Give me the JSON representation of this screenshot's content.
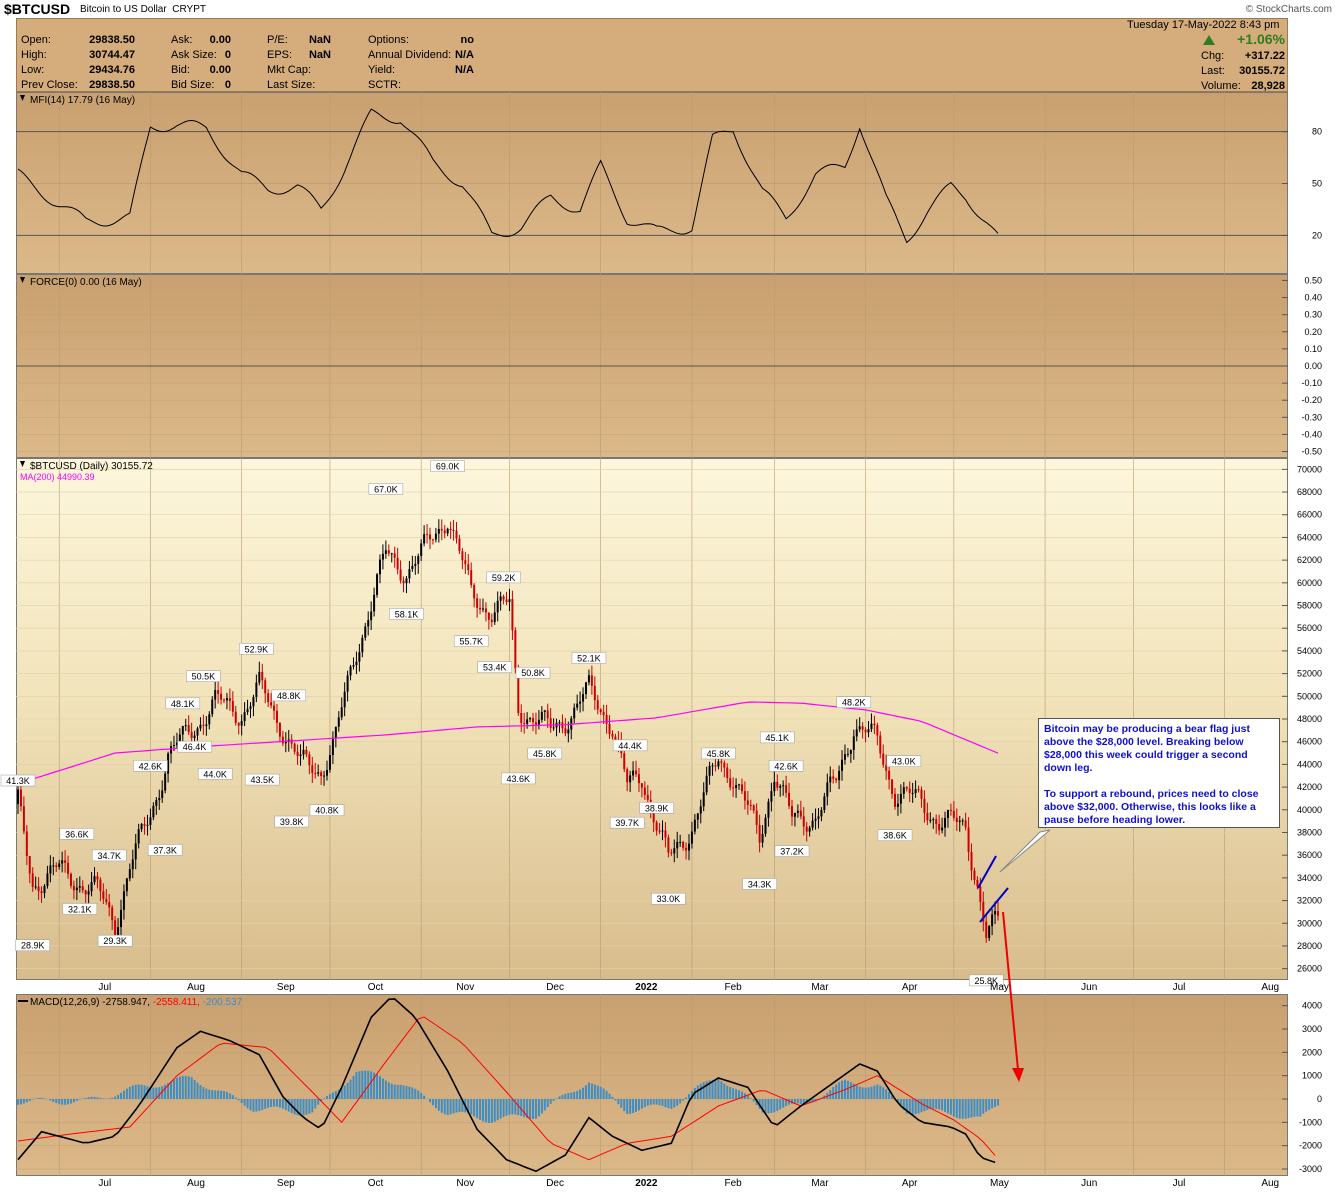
{
  "header": {
    "symbol": "$BTCUSD",
    "description": "Bitcoin to US Dollar",
    "exchange": "CRYPT",
    "date": "Tuesday  17-May-2022  8:43 pm",
    "brand": "© StockCharts.com",
    "stats": {
      "open_label": "Open:",
      "open": "29838.50",
      "high_label": "High:",
      "high": "30744.47",
      "low_label": "Low:",
      "low": "29434.76",
      "prev_label": "Prev Close:",
      "prev": "29838.50",
      "ask_label": "Ask:",
      "ask": "0.00",
      "asksize_label": "Ask Size:",
      "asksize": "0",
      "bid_label": "Bid:",
      "bid": "0.00",
      "bidsize_label": "Bid Size:",
      "bidsize": "0",
      "pe_label": "P/E:",
      "pe": "NaN",
      "eps_label": "EPS:",
      "eps": "NaN",
      "mktcap_label": "Mkt Cap:",
      "lastsize_label": "Last Size:",
      "options_label": "Options:",
      "options": "no",
      "div_label": "Annual Dividend:",
      "div": "N/A",
      "yield_label": "Yield:",
      "yield": "N/A",
      "sctr_label": "SCTR:",
      "pct": "+1.06%",
      "chg_label": "Chg:",
      "chg": "+317.22",
      "last_label": "Last:",
      "last": "30155.72",
      "vol_label": "Volume:",
      "vol": "28,928"
    }
  },
  "colors": {
    "panel_bg": "#d5ad7c",
    "mfi_fill": "#4a6a30",
    "ma_line": "#ff00ff",
    "price_up": "#000000",
    "price_down": "#cc0000",
    "macd_line": "#000000",
    "signal_line": "#ff0000",
    "histogram": "#3b8ec8",
    "annotation": "#1010cc"
  },
  "chart_data": [
    {
      "type": "line",
      "title": "MFI(14) 17.79 (16 May)",
      "ylim": [
        0,
        100
      ],
      "yticks": [
        "80",
        "50",
        "20"
      ],
      "reference_lines": [
        80,
        20
      ],
      "x": [
        "2021-06-17",
        "2021-07-01",
        "2021-07-10",
        "2021-07-25",
        "2021-08-01",
        "2021-08-10",
        "2021-08-20",
        "2021-09-01",
        "2021-09-10",
        "2021-09-20",
        "2021-09-28",
        "2021-10-05",
        "2021-10-15",
        "2021-10-25",
        "2021-11-05",
        "2021-11-15",
        "2021-11-25",
        "2021-12-05",
        "2021-12-15",
        "2021-12-25",
        "2022-01-01",
        "2022-01-10",
        "2022-01-20",
        "2022-02-01",
        "2022-02-08",
        "2022-02-15",
        "2022-02-25",
        "2022-03-05",
        "2022-03-15",
        "2022-03-25",
        "2022-03-30",
        "2022-04-08",
        "2022-04-15",
        "2022-04-22",
        "2022-04-30",
        "2022-05-05",
        "2022-05-12",
        "2022-05-16"
      ],
      "values": [
        55,
        38,
        28,
        30,
        83,
        84,
        82,
        55,
        47,
        48,
        35,
        56,
        90,
        88,
        62,
        50,
        20,
        25,
        42,
        35,
        60,
        30,
        22,
        25,
        75,
        82,
        45,
        30,
        55,
        60,
        85,
        40,
        18,
        34,
        48,
        43,
        28,
        18
      ]
    },
    {
      "type": "line",
      "title": "FORCE(0) 0.00 (16 May)",
      "ylim": [
        -0.5,
        0.5
      ],
      "yticks": [
        "0.50",
        "0.40",
        "0.30",
        "0.20",
        "0.10",
        "0.00",
        "-0.10",
        "-0.20",
        "-0.30",
        "-0.40",
        "-0.50"
      ],
      "values": [
        0
      ]
    },
    {
      "type": "line",
      "title": "$BTCUSD (Daily) 30155.72",
      "legend": [
        "MA(200) 44990.39"
      ],
      "ylim": [
        25000,
        71000
      ],
      "yticks": [
        "70000",
        "68000",
        "66000",
        "64000",
        "62000",
        "60000",
        "58000",
        "56000",
        "54000",
        "52000",
        "50000",
        "48000",
        "46000",
        "44000",
        "42000",
        "40000",
        "38000",
        "36000",
        "34000",
        "32000",
        "30000",
        "28000",
        "26000"
      ],
      "xticks": [
        "Jul",
        "Aug",
        "Sep",
        "Oct",
        "Nov",
        "Dec",
        "2022",
        "Feb",
        "Mar",
        "Apr",
        "May",
        "Jun",
        "Jul",
        "Aug"
      ],
      "x": [
        "2021-06-17",
        "2021-06-22",
        "2021-07-01",
        "2021-07-09",
        "2021-07-14",
        "2021-07-20",
        "2021-07-25",
        "2021-08-01",
        "2021-08-07",
        "2021-08-15",
        "2021-08-23",
        "2021-09-01",
        "2021-09-07",
        "2021-09-15",
        "2021-09-21",
        "2021-09-28",
        "2021-10-03",
        "2021-10-10",
        "2021-10-20",
        "2021-10-27",
        "2021-11-01",
        "2021-11-10",
        "2021-11-18",
        "2021-11-25",
        "2021-12-01",
        "2021-12-04",
        "2021-12-10",
        "2021-12-15",
        "2021-12-22",
        "2021-12-28",
        "2022-01-05",
        "2022-01-10",
        "2022-01-15",
        "2022-01-24",
        "2022-02-01",
        "2022-02-10",
        "2022-02-15",
        "2022-02-24",
        "2022-03-01",
        "2022-03-07",
        "2022-03-15",
        "2022-03-22",
        "2022-03-28",
        "2022-04-05",
        "2022-04-11",
        "2022-04-20",
        "2022-04-26",
        "2022-05-05",
        "2022-05-09",
        "2022-05-12",
        "2022-05-16"
      ],
      "values": [
        40500,
        33500,
        34700,
        33500,
        32800,
        30000,
        35000,
        39500,
        44800,
        47000,
        49500,
        48500,
        50800,
        47200,
        44000,
        43500,
        46500,
        54000,
        62500,
        61000,
        62500,
        66000,
        59000,
        57500,
        58000,
        49000,
        48000,
        47000,
        48500,
        50500,
        47500,
        42000,
        43000,
        35500,
        38500,
        44500,
        43000,
        37500,
        43500,
        39000,
        39500,
        42500,
        47500,
        46000,
        41500,
        40700,
        39000,
        38500,
        33500,
        28800,
        30155.72
      ],
      "ma200": {
        "x": [
          "2021-06-17",
          "2021-07-20",
          "2021-08-20",
          "2021-09-20",
          "2021-10-20",
          "2021-11-20",
          "2021-12-20",
          "2022-01-20",
          "2022-02-20",
          "2022-03-10",
          "2022-04-01",
          "2022-04-20",
          "2022-05-16"
        ],
        "values": [
          42300,
          45000,
          45600,
          46100,
          46600,
          47300,
          47500,
          48100,
          49500,
          49400,
          48800,
          47800,
          44990.39
        ]
      },
      "annotations": [
        "41.3K",
        "36.6K",
        "34.7K",
        "32.1K",
        "28.9K",
        "29.3K",
        "37.3K",
        "42.6K",
        "48.1K",
        "44.0K",
        "46.4K",
        "50.5K",
        "52.9K",
        "43.5K",
        "48.8K",
        "39.8K",
        "40.8K",
        "67.0K",
        "58.1K",
        "69.0K",
        "55.7K",
        "59.2K",
        "53.4K",
        "50.8K",
        "43.6K",
        "45.8K",
        "52.1K",
        "44.4K",
        "39.7K",
        "38.9K",
        "33.0K",
        "45.8K",
        "34.3K",
        "45.1K",
        "42.6K",
        "37.2K",
        "48.2K",
        "43.0K",
        "38.6K",
        "25.8K"
      ]
    },
    {
      "type": "line",
      "title": "MACD(12,26,9) -2758.947, -2558.411, -200.537",
      "ylim": [
        -3300,
        4500
      ],
      "yticks": [
        "4000",
        "3000",
        "2000",
        "1000",
        "0",
        "-1000",
        "-2000",
        "-3000"
      ],
      "xticks": [
        "Jul",
        "Aug",
        "Sep",
        "Oct",
        "Nov",
        "Dec",
        "2022",
        "Feb",
        "Mar",
        "Apr",
        "May",
        "Jun",
        "Jul",
        "Aug"
      ],
      "series": [
        {
          "name": "MACD(12,26,9)",
          "x": [
            "2021-06-17",
            "2021-06-25",
            "2021-07-10",
            "2021-07-20",
            "2021-07-28",
            "2021-08-10",
            "2021-08-18",
            "2021-08-28",
            "2021-09-07",
            "2021-09-15",
            "2021-09-22",
            "2021-09-28",
            "2021-10-05",
            "2021-10-15",
            "2021-10-22",
            "2021-10-30",
            "2021-11-10",
            "2021-11-20",
            "2021-11-30",
            "2021-12-10",
            "2021-12-20",
            "2021-12-28",
            "2022-01-05",
            "2022-01-15",
            "2022-01-25",
            "2022-02-01",
            "2022-02-10",
            "2022-02-20",
            "2022-03-01",
            "2022-03-10",
            "2022-03-20",
            "2022-03-30",
            "2022-04-05",
            "2022-04-12",
            "2022-04-20",
            "2022-04-30",
            "2022-05-05",
            "2022-05-10",
            "2022-05-16"
          ],
          "values": [
            -2600,
            -1400,
            -1900,
            -1600,
            -300,
            2200,
            2900,
            2500,
            1900,
            100,
            -800,
            -1300,
            500,
            3500,
            4400,
            3500,
            1200,
            -1300,
            -2600,
            -3100,
            -2400,
            -800,
            -1600,
            -2200,
            -1900,
            200,
            900,
            500,
            -1200,
            -300,
            600,
            1500,
            1200,
            -200,
            -1000,
            -1200,
            -1500,
            -2500,
            -2758.947
          ]
        },
        {
          "name": "Signal",
          "x": [
            "2021-06-17",
            "2021-07-05",
            "2021-07-25",
            "2021-08-10",
            "2021-08-25",
            "2021-09-10",
            "2021-09-25",
            "2021-10-05",
            "2021-10-20",
            "2021-11-01",
            "2021-11-15",
            "2021-11-30",
            "2021-12-15",
            "2021-12-28",
            "2022-01-10",
            "2022-01-25",
            "2022-02-10",
            "2022-02-25",
            "2022-03-10",
            "2022-03-25",
            "2022-04-05",
            "2022-04-20",
            "2022-05-01",
            "2022-05-10",
            "2022-05-16"
          ],
          "values": [
            -1800,
            -1500,
            -1200,
            1000,
            2400,
            2200,
            300,
            -1000,
            1600,
            3600,
            2400,
            300,
            -1900,
            -2600,
            -1900,
            -1600,
            -300,
            400,
            -300,
            400,
            1000,
            -200,
            -900,
            -1700,
            -2558.411
          ]
        },
        {
          "name": "Histogram",
          "x": [
            "2021-06-17",
            "2021-07-10",
            "2021-07-28",
            "2021-08-15",
            "2021-09-05",
            "2021-09-25",
            "2021-10-10",
            "2021-10-25",
            "2021-11-10",
            "2021-11-25",
            "2021-12-10",
            "2021-12-28",
            "2022-01-10",
            "2022-01-25",
            "2022-02-10",
            "2022-02-25",
            "2022-03-10",
            "2022-03-25",
            "2022-04-05",
            "2022-04-15",
            "2022-04-30",
            "2022-05-10",
            "2022-05-16"
          ],
          "values": [
            -100,
            -100,
            500,
            900,
            -400,
            -600,
            1200,
            700,
            -600,
            -900,
            -700,
            800,
            -500,
            -300,
            1000,
            -500,
            -300,
            700,
            600,
            -500,
            -600,
            -900,
            -200.537
          ]
        }
      ]
    }
  ],
  "note": {
    "p1": "Bitcoin may be producing a bear flag just above the $28,000 level. Breaking below $28,000 this week could trigger a second down leg.",
    "p2": "To support a rebound, prices need to close above $32,000. Otherwise, this looks like a pause before heading lower."
  }
}
